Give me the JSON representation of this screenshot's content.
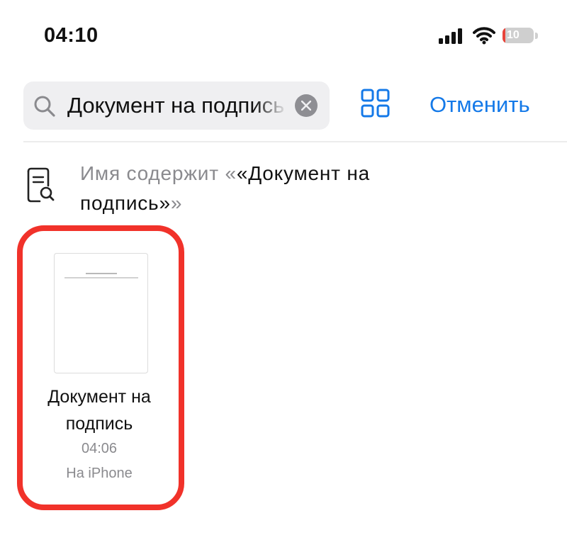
{
  "status_bar": {
    "time": "04:10",
    "battery_level": "10",
    "battery_fraction": 0.1,
    "battery_color": "#e8443a",
    "icons": [
      "signal-icon",
      "wifi-icon",
      "battery-charging-icon"
    ]
  },
  "search": {
    "query": "Документ на подпись",
    "clear_icon": "clear-icon",
    "search_icon": "search-icon"
  },
  "toolbar": {
    "grid_icon": "grid-view-icon",
    "cancel_label": "Отменить",
    "accent_color": "#1479e8"
  },
  "suggestion": {
    "icon": "document-search-icon",
    "prefix": "Имя содержит «",
    "term": "«Документ на подпись»",
    "suffix": "»"
  },
  "results": [
    {
      "name": "Документ на подпись",
      "time": "04:06",
      "location": "На iPhone",
      "highlighted": true,
      "highlight_color": "#f1322a"
    }
  ]
}
